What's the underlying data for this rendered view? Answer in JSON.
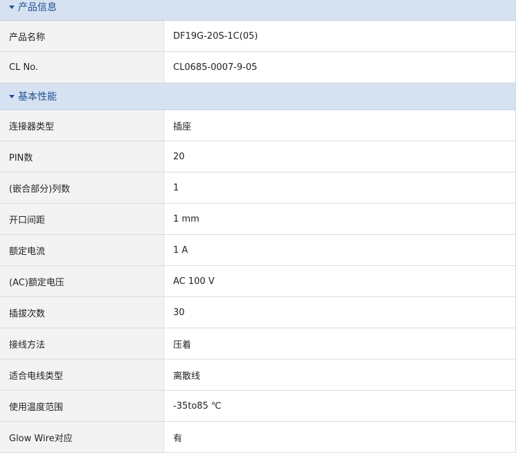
{
  "sections": [
    {
      "title": "产品信息",
      "rows": [
        {
          "label": "产品名称",
          "value": "DF19G-20S-1C(05)"
        },
        {
          "label": "CL No.",
          "value": "CL0685-0007-9-05"
        }
      ]
    },
    {
      "title": "基本性能",
      "rows": [
        {
          "label": "连接器类型",
          "value": "插座"
        },
        {
          "label": "PIN数",
          "value": "20"
        },
        {
          "label": "(嵌合部分)列数",
          "value": "1"
        },
        {
          "label": "开口间距",
          "value": "1 mm"
        },
        {
          "label": "额定电流",
          "value": "1 A"
        },
        {
          "label": "(AC)额定电压",
          "value": "AC 100 V"
        },
        {
          "label": "插拔次数",
          "value": "30"
        },
        {
          "label": "接线方法",
          "value": "压着"
        },
        {
          "label": "适合电线类型",
          "value": "离散线"
        },
        {
          "label": "使用温度范围",
          "value": "-35to85 ℃"
        },
        {
          "label": "Glow Wire对应",
          "value": "有"
        }
      ]
    }
  ],
  "icons": {
    "section_toggle": "caret-down-icon"
  },
  "colors": {
    "section_header_bg": "#d6e2f1",
    "section_header_text": "#1f4e92",
    "label_bg": "#f3f3f3",
    "border": "#dcdcdc"
  }
}
